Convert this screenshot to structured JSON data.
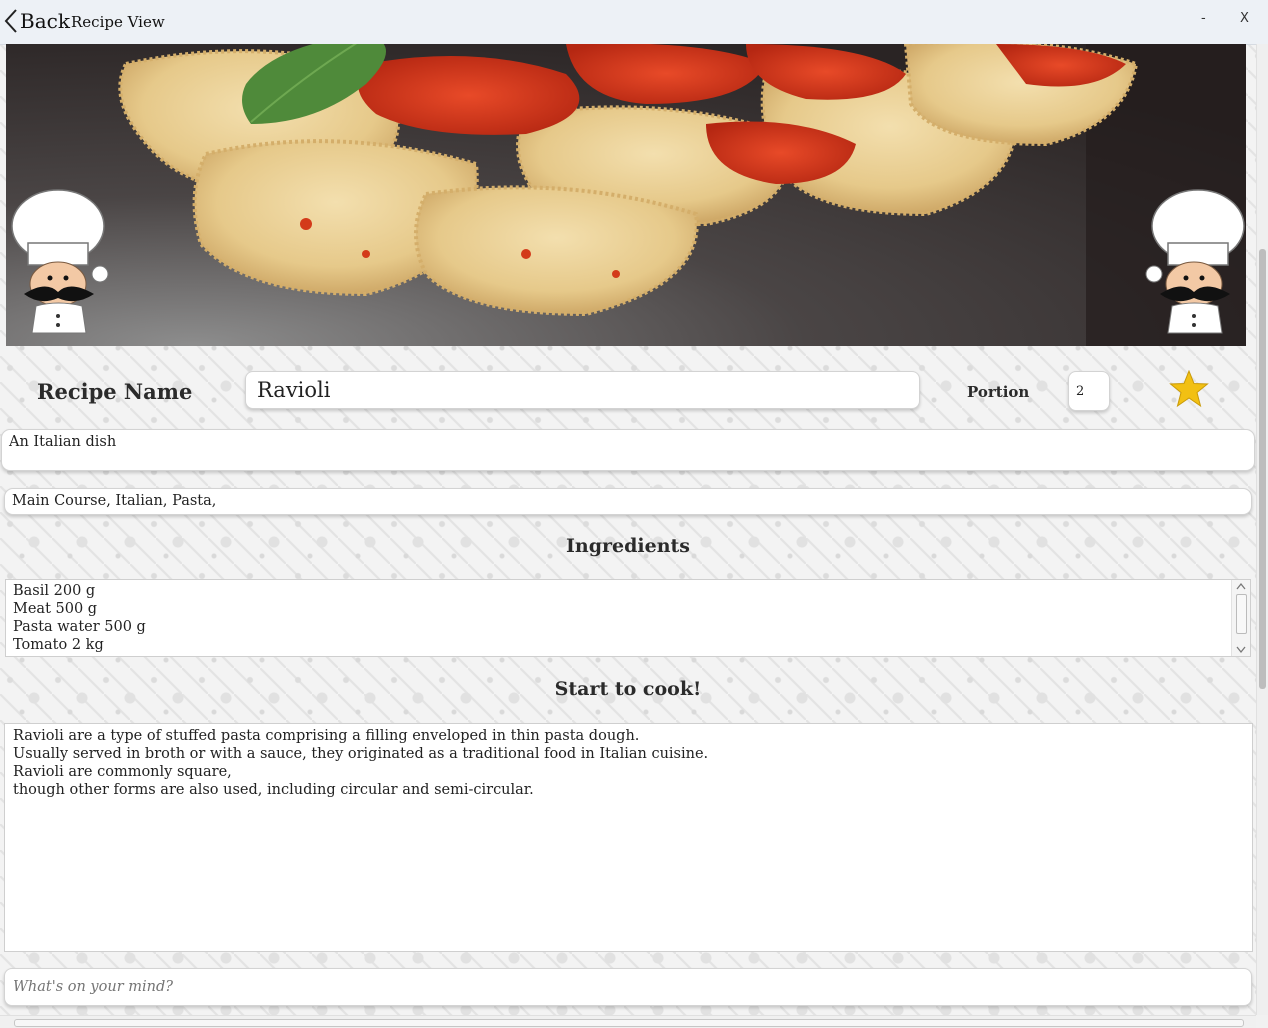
{
  "window": {
    "back_label": "Back",
    "title": "Recipe View",
    "minimize_label": "-",
    "close_label": "X"
  },
  "recipe": {
    "name_label": "Recipe Name",
    "name_value": "Ravioli",
    "portion_label": "Portion",
    "portion_value": "2",
    "favorite": true,
    "favorite_color": "#f2c013",
    "description": "An Italian dish",
    "tags": "Main Course,  Italian,  Pasta,"
  },
  "ingredients": {
    "title": "Ingredients",
    "items": [
      "Basil 200 g",
      "Meat 500 g",
      "Pasta water 500 g",
      "Tomato 2 kg"
    ]
  },
  "instructions": {
    "title": "Start to cook!",
    "lines": [
      "Ravioli are a type of stuffed pasta comprising a filling enveloped in thin pasta dough.",
      "Usually served in broth or with a sauce, they originated as a traditional food in Italian cuisine.",
      "Ravioli are commonly square,",
      "though other forms are also used, including circular and semi-circular."
    ]
  },
  "comment": {
    "placeholder": "What's on your mind?"
  }
}
